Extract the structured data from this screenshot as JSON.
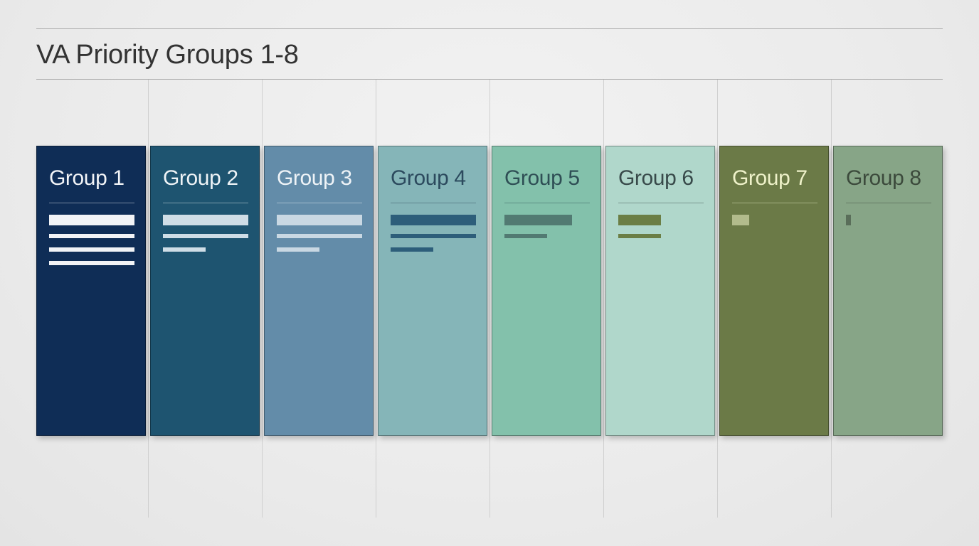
{
  "header": {
    "title": "VA Priority Groups 1-8"
  },
  "groups": [
    {
      "label": "Group 1",
      "bg": "#0f2d56",
      "text": "#f2f4f7",
      "bar": "#f1f3f6"
    },
    {
      "label": "Group 2",
      "bg": "#1e5470",
      "text": "#eef3f6",
      "bar": "#cfdde6"
    },
    {
      "label": "Group 3",
      "bg": "#638ca9",
      "text": "#eef3f7",
      "bar": "#c9d8e3"
    },
    {
      "label": "Group 4",
      "bg": "#85b5b8",
      "text": "#2c4a5e",
      "bar": "#2d5e7a"
    },
    {
      "label": "Group 5",
      "bg": "#83c1ab",
      "text": "#2f4f55",
      "bar": "#527a72"
    },
    {
      "label": "Group 6",
      "bg": "#b0d7cb",
      "text": "#384a4a",
      "bar": "#6b7e45"
    },
    {
      "label": "Group 7",
      "bg": "#6b7a47",
      "text": "#eef1c9",
      "bar": "#b2bb8c"
    },
    {
      "label": "Group 8",
      "bg": "#87a587",
      "text": "#3c4a3c",
      "bar": "#5a6e5a"
    }
  ]
}
